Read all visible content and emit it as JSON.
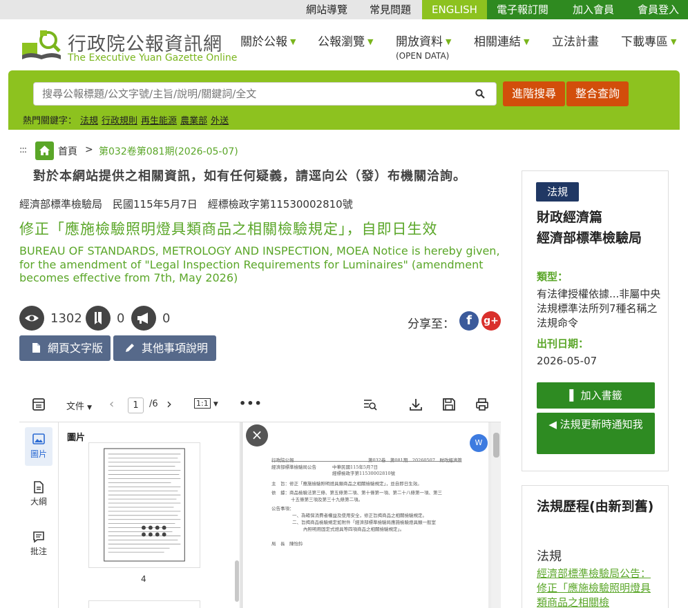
{
  "topbar": {
    "links": [
      "網站導覽",
      "常見問題",
      "ENGLISH",
      "電子報訂閱",
      "加入會員",
      "會員登入"
    ]
  },
  "logo": {
    "cn": "行政院公報資訊網",
    "en": "The Executive Yuan Gazette Online"
  },
  "nav": {
    "items": [
      "關於公報",
      "公報瀏覽",
      "開放資料",
      "相關連結",
      "立法計畫",
      "下載專區"
    ],
    "open_data_sub": "(OPEN DATA)"
  },
  "search": {
    "placeholder": "搜尋公報標題/公文字號/主旨/說明/關鍵詞/全文",
    "advanced_label": "進階搜尋",
    "integrated_label": "整合查詢"
  },
  "hot_keywords": {
    "label": "熱門關鍵字：",
    "items": [
      "法規",
      "行政規則",
      "再生能源",
      "農業部",
      "外送"
    ]
  },
  "breadcrumb": {
    "home": "首頁",
    "sep": ">",
    "current": "第032卷第081期(2026-05-07)"
  },
  "notice": "對於本網站提供之相關資訊，如有任何疑義，請逕向公（發）布機關洽詢。",
  "article": {
    "meta": "經濟部標準檢驗局　民國115年5月7日　經標檢政字第11530002810號",
    "title_cn": "修正「應施檢驗照明燈具類商品之相關檢驗規定」，自即日生效",
    "title_en": "BUREAU OF STANDARDS, METROLOGY AND INSPECTION, MOEA Notice is hereby given, for the amendment of \"Legal Inspection Requirements for Luminaires\" (amendment becomes effective from 7th, May 2026)"
  },
  "stats": {
    "views": "1302",
    "bookmarks": "0",
    "notifications": "0"
  },
  "share": {
    "label": "分享至：",
    "fb": "f",
    "gplus": "g+"
  },
  "buttons": {
    "text_version": "網頁文字版",
    "other_notes": "其他事項說明"
  },
  "viewer": {
    "file_label": "文件",
    "page_current": "1",
    "page_total": "/6",
    "zoom": "1:1",
    "sidebar": [
      "圖片",
      "大綱",
      "批注"
    ],
    "panel_title": "圖片",
    "thumb_number": "4",
    "close": "×",
    "word": "W",
    "doc": {
      "header_left": "行政院公報",
      "header_right": "第032卷　第081期　20260507　財政經濟篇",
      "issuer": "經濟部標準檢驗局公告",
      "date": "中華民國115年5月7日",
      "doc_no": "經標檢政字第11530002810號",
      "subject": "主　旨：修正「應施檢驗照明燈具類商品之相關檢驗規定」，並自即日生效。",
      "basis1": "依　據：商品檢驗法第三條、第五條第二項、第十條第一項、第二十八條第一項、第三",
      "basis2": "十五條第三項及第三十九條第二項。",
      "items_label": "公告事項：",
      "item1": "一、為確保消費者權益及使用安全，修正旨揭商品之相關檢驗規定。",
      "item2a": "二、旨揭商品檢驗規定如附件「經濟部標準檢驗局應施檢驗燈具類一般室",
      "item2b": "內照明用固定式燈具等四項商品之相關檢驗規定」。",
      "signer": "局　長　陳怡鈴"
    }
  },
  "right_panel": {
    "tag": "法規",
    "category": "財政經濟篇",
    "agency": "經濟部標準檢驗局",
    "type_label": "類型：",
    "type_value": "有法律授權依據...非屬中央法規標準法所列7種名稱之法規命令",
    "date_label": "出刊日期：",
    "date_value": "2026-05-07",
    "bookmark_btn": "加入書籤",
    "notify_btn": "法規更新時通知我"
  },
  "history": {
    "title": "法規歷程(由新到舊)",
    "sub": "法規",
    "link": "經濟部標準檢驗局公告：修正「應施檢驗照明燈具類商品之相關檢"
  },
  "colors": {
    "brand_green": "#8dc21f",
    "text_green": "#5aa628",
    "action_orange": "#d24e0b",
    "button_slate": "#56698a",
    "tag_navy": "#203864",
    "button_dark_green": "#2e8b22"
  }
}
